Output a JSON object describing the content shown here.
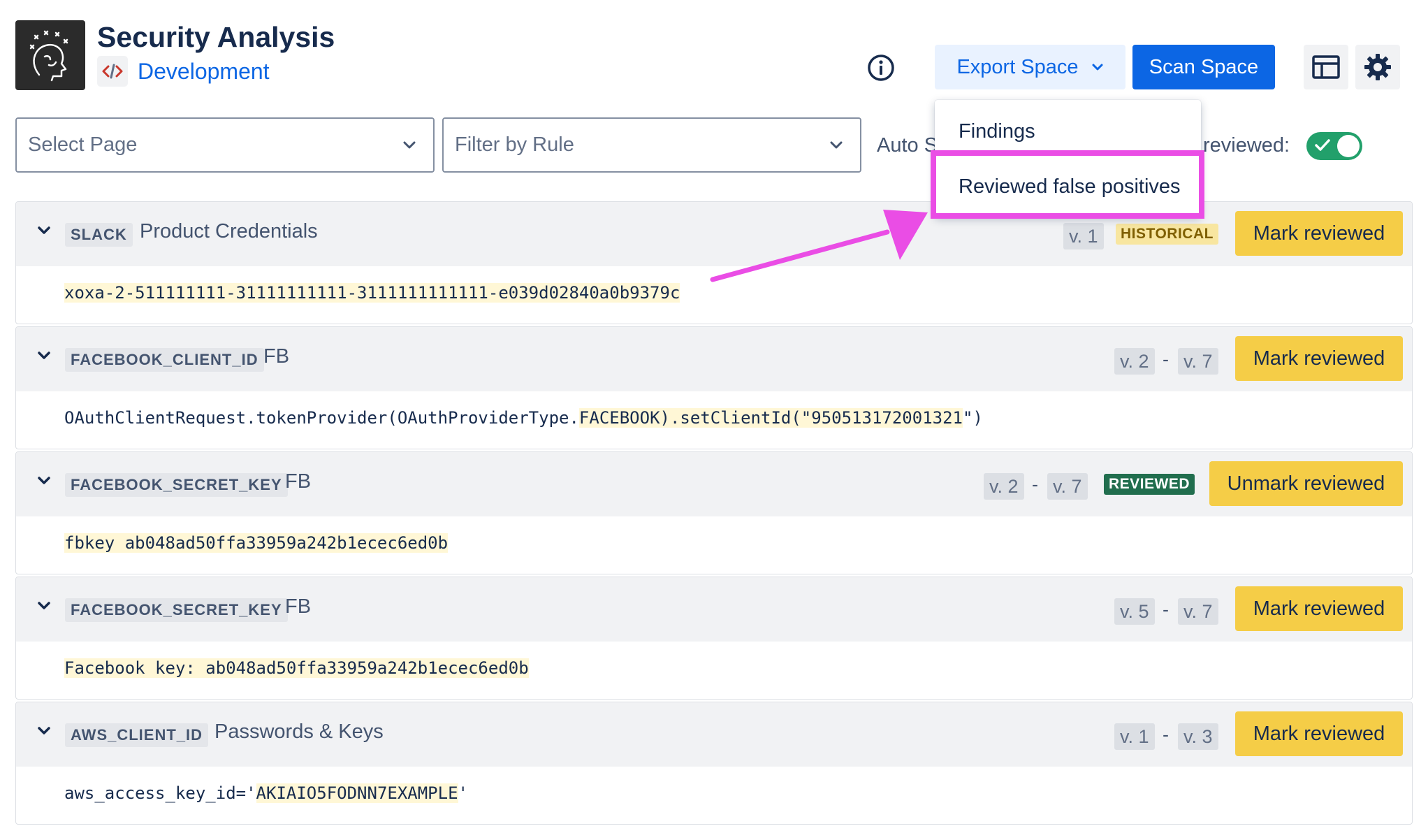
{
  "header": {
    "app_title": "Security Analysis",
    "space_name": "Development"
  },
  "toolbar": {
    "export_label": "Export Space",
    "scan_label": "Scan Space"
  },
  "filters": {
    "page_placeholder": "Select Page",
    "rule_placeholder": "Filter by Rule",
    "auto_label_visible": "Auto S",
    "reviewed_label_visible": "reviewed:",
    "reviewed_toggle_on": true
  },
  "export_menu": {
    "items": [
      "Findings",
      "Reviewed false positives"
    ]
  },
  "colors": {
    "primary": "#0c66e4",
    "mark_button": "#f5cd47",
    "reviewed_tag": "#216e4e",
    "historical_tag": "#f8e6a0",
    "annotation": "#ea4de5",
    "toggle_on": "#22a06b"
  },
  "findings": [
    {
      "rule": "SLACK",
      "title": "Product Credentials",
      "version_from": "v. 1",
      "version_to": "",
      "tag": "HISTORICAL",
      "action": "Mark reviewed",
      "snippet_pre": "",
      "snippet_hl": "xoxa-2-511111111-31111111111-3111111111111-e039d02840a0b9379c",
      "snippet_post": ""
    },
    {
      "rule": "FACEBOOK_CLIENT_ID",
      "title": "FB",
      "version_from": "v. 2",
      "version_to": "v. 7",
      "tag": "",
      "action": "Mark reviewed",
      "snippet_pre": "OAuthClientRequest.tokenProvider(OAuthProviderType.",
      "snippet_hl": "FACEBOOK).setClientId(\"950513172001321",
      "snippet_post": "\")"
    },
    {
      "rule": "FACEBOOK_SECRET_KEY",
      "title": "FB",
      "version_from": "v. 2",
      "version_to": "v. 7",
      "tag": "REVIEWED",
      "action": "Unmark reviewed",
      "snippet_pre": "",
      "snippet_hl": "fbkey ab048ad50ffa33959a242b1ecec6ed0b",
      "snippet_post": ""
    },
    {
      "rule": "FACEBOOK_SECRET_KEY",
      "title": "FB",
      "version_from": "v. 5",
      "version_to": "v. 7",
      "tag": "",
      "action": "Mark reviewed",
      "snippet_pre": "",
      "snippet_hl": "Facebook key: ab048ad50ffa33959a242b1ecec6ed0b",
      "snippet_post": ""
    },
    {
      "rule": "AWS_CLIENT_ID",
      "title": "Passwords & Keys",
      "version_from": "v. 1",
      "version_to": "v. 3",
      "tag": "",
      "action": "Mark reviewed",
      "snippet_pre": "aws_access_key_id='",
      "snippet_hl": "AKIAIO5FODNN7EXAMPLE",
      "snippet_post": "'"
    }
  ]
}
